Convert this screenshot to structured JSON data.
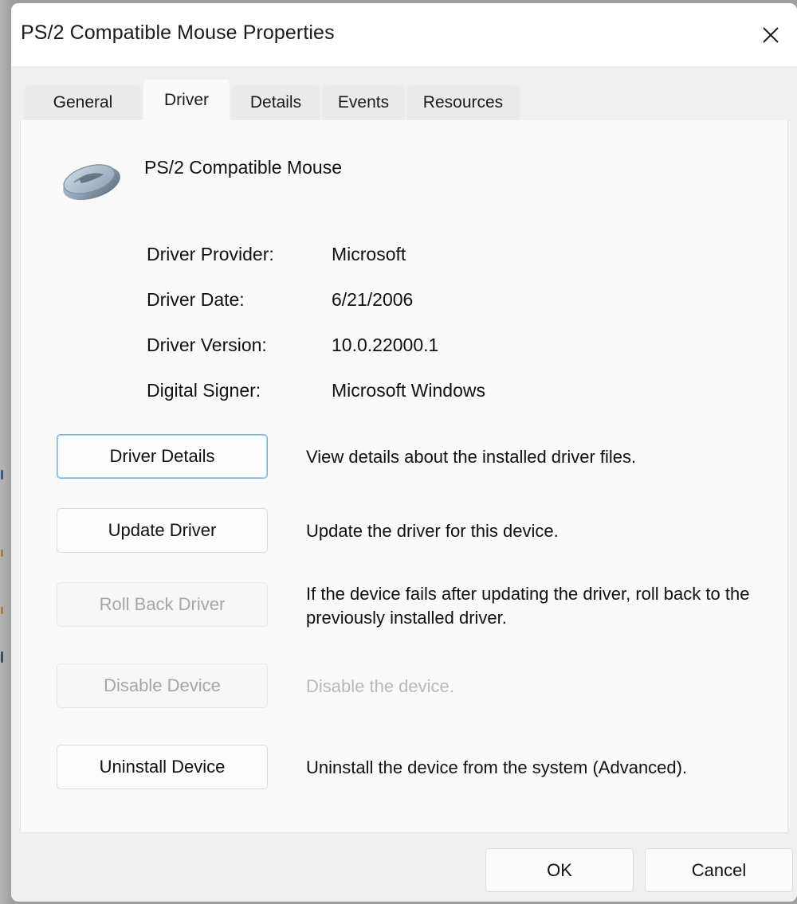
{
  "window": {
    "title": "PS/2 Compatible Mouse Properties",
    "close_icon": "close-icon",
    "accent_color": "#74b2e2",
    "titlebar_bg": "#ffffff",
    "dialog_bg": "#f0f0f0",
    "content_bg": "#fafafa"
  },
  "tabs": [
    {
      "label": "General",
      "active": false
    },
    {
      "label": "Driver",
      "active": true
    },
    {
      "label": "Details",
      "active": false
    },
    {
      "label": "Events",
      "active": false
    },
    {
      "label": "Resources",
      "active": false
    }
  ],
  "device": {
    "icon": "mouse-icon",
    "name": "PS/2 Compatible Mouse"
  },
  "driver_info": [
    {
      "label": "Driver Provider:",
      "value": "Microsoft"
    },
    {
      "label": "Driver Date:",
      "value": "6/21/2006"
    },
    {
      "label": "Driver Version:",
      "value": "10.0.22000.1"
    },
    {
      "label": "Digital Signer:",
      "value": "Microsoft Windows"
    }
  ],
  "actions": [
    {
      "label": "Driver Details",
      "description": "View details about the installed driver files.",
      "disabled": false,
      "focused": true
    },
    {
      "label": "Update Driver",
      "description": "Update the driver for this device.",
      "disabled": false,
      "focused": false
    },
    {
      "label": "Roll Back Driver",
      "description": "If the device fails after updating the driver, roll back to the previously installed driver.",
      "disabled": true,
      "description_disabled": false,
      "focused": false
    },
    {
      "label": "Disable Device",
      "description": "Disable the device.",
      "disabled": true,
      "description_disabled": true,
      "focused": false
    },
    {
      "label": "Uninstall Device",
      "description": "Uninstall the device from the system (Advanced).",
      "disabled": false,
      "focused": false
    }
  ],
  "footer": {
    "ok_label": "OK",
    "cancel_label": "Cancel"
  }
}
